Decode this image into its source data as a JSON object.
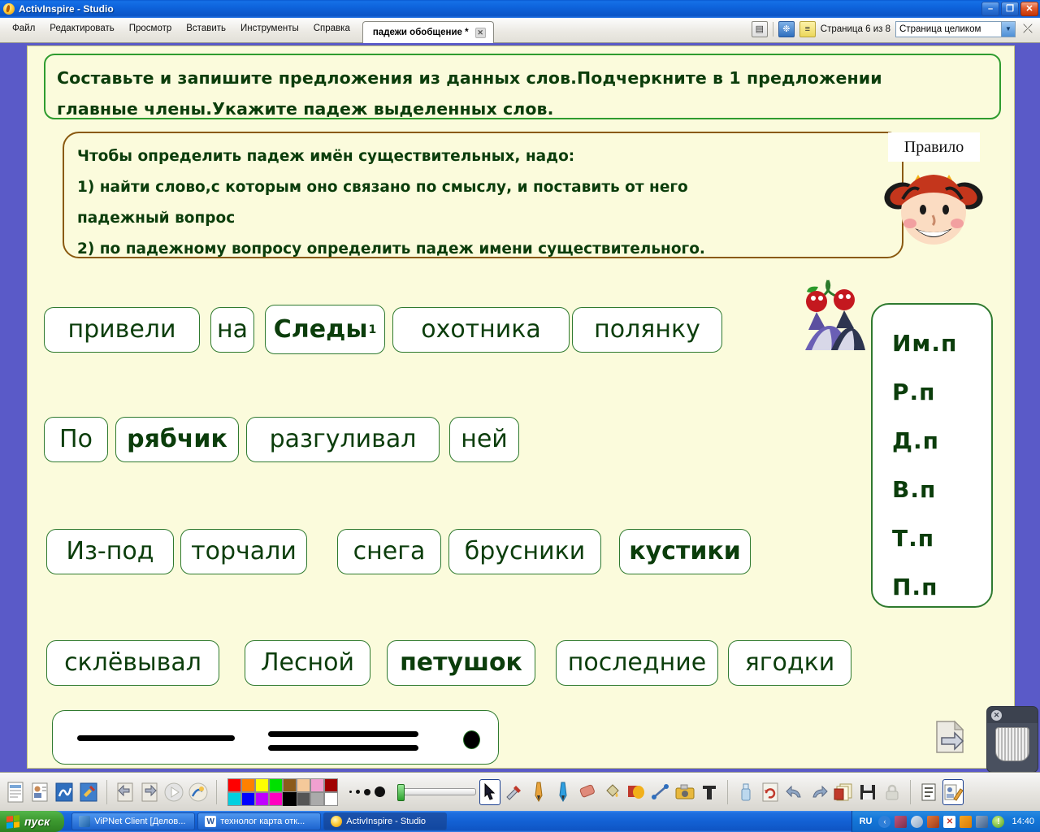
{
  "window": {
    "title": "ActivInspire - Studio",
    "app_icon": "flame-icon",
    "controls": {
      "minimize": "–",
      "restore": "❐",
      "close": "✕"
    }
  },
  "menubar": {
    "items": [
      "Файл",
      "Редактировать",
      "Просмотр",
      "Вставить",
      "Инструменты",
      "Справка"
    ],
    "document_tab": {
      "label": "падежи обобщение *",
      "close": "✕"
    },
    "right": {
      "page_status": "Страница 6 из 8",
      "zoom_select": "Страница целиком",
      "icons": [
        "page-view-icon",
        "snowflake-icon",
        "notes-icon",
        "fullscreen-icon"
      ]
    }
  },
  "page": {
    "instruction": {
      "line1": "Составьте и запишите предложения из данных слов.Подчеркните в 1 предложении",
      "line2": "главные члены.Укажите падеж выделенных слов."
    },
    "rule": {
      "label": "Правило",
      "line1": "Чтобы определить падеж имён существительных, надо:",
      "line2": "1) найти слово,с которым оно связано по смыслу, и поставить от него",
      "line3": "падежный вопрос",
      "line4": "2) по падежному вопросу определить падеж имени существительного."
    },
    "cases": [
      "Им.п",
      "Р.п",
      "Д.п",
      "В.п",
      "Т.п",
      "П.п"
    ],
    "word_rows": [
      [
        {
          "text": "привели",
          "bold": false,
          "sup": ""
        },
        {
          "text": "на",
          "bold": false,
          "sup": ""
        },
        {
          "text": "Следы",
          "bold": true,
          "sup": "1"
        },
        {
          "text": "охотника",
          "bold": false,
          "sup": ""
        },
        {
          "text": "полянку",
          "bold": false,
          "sup": ""
        }
      ],
      [
        {
          "text": "По",
          "bold": false,
          "sup": ""
        },
        {
          "text": "рябчик",
          "bold": true,
          "sup": ""
        },
        {
          "text": "разгуливал",
          "bold": false,
          "sup": ""
        },
        {
          "text": "ней",
          "bold": false,
          "sup": ""
        }
      ],
      [
        {
          "text": "Из-под",
          "bold": false,
          "sup": ""
        },
        {
          "text": "торчали",
          "bold": false,
          "sup": ""
        },
        {
          "text": "снега",
          "bold": false,
          "sup": ""
        },
        {
          "text": "брусники",
          "bold": false,
          "sup": ""
        },
        {
          "text": "кустики",
          "bold": true,
          "sup": ""
        }
      ],
      [
        {
          "text": "склёвывал",
          "bold": false,
          "sup": ""
        },
        {
          "text": "Лесной",
          "bold": false,
          "sup": ""
        },
        {
          "text": "петушок",
          "bold": true,
          "sup": ""
        },
        {
          "text": "последние",
          "bold": false,
          "sup": ""
        },
        {
          "text": "ягодки",
          "bold": false,
          "sup": ""
        }
      ]
    ],
    "legend": {
      "symbols": [
        "single-underline",
        "double-underline",
        "dot"
      ]
    },
    "next_page_icon": "next-page-arrow-icon",
    "trash_icon": "trash-bin-icon"
  },
  "toolbar": {
    "icons": [
      "properties-icon",
      "profile-icon",
      "handwriting-icon",
      "settings-icon",
      "prev-page-icon",
      "next-page-icon",
      "play-icon",
      "magic-ink-icon",
      "cursor-icon",
      "tools-icon",
      "pen-icon",
      "highlighter-icon",
      "eraser-icon",
      "fill-icon",
      "shapes-icon",
      "connector-icon",
      "camera-icon",
      "text-icon",
      "clear-icon",
      "reset-icon",
      "undo-icon",
      "redo-icon",
      "duplicate-icon",
      "save-icon",
      "lock-icon",
      "page-notes-icon",
      "annotate-icon"
    ],
    "palette_row1": [
      "#ff0000",
      "#ff8000",
      "#ffff00",
      "#00e000",
      "#8b5a1a",
      "#f5c99a",
      "#f0a0d0",
      "#a00000"
    ],
    "palette_row2": [
      "#00d0e0",
      "#0000ff",
      "#c000ff",
      "#ff00c0",
      "#000000",
      "#555555",
      "#aaaaaa",
      "#ffffff"
    ],
    "selected_color": "#000000",
    "pen_sizes": [
      3,
      5,
      8,
      13
    ],
    "selected_tool": "cursor-icon"
  },
  "taskbar": {
    "start_label": "пуск",
    "tasks": [
      {
        "label": "ViPNet Client [Делов...",
        "icon": "vipnet-icon",
        "active": false
      },
      {
        "label": "технолог карта отк...",
        "icon": "word-icon",
        "active": false
      },
      {
        "label": "ActivInspire - Studio",
        "icon": "flame-icon",
        "active": true
      }
    ],
    "tray": {
      "language": "RU",
      "clock": "14:40",
      "icons": [
        "show-desktop-icon",
        "network-icon",
        "search-icon",
        "cleaner-icon",
        "antivirus-icon",
        "orange-icon",
        "connection-icon",
        "info-icon"
      ]
    }
  },
  "colors": {
    "canvas": "#fbfbdc",
    "desktop": "#5a5ac8",
    "ink_green": "#0b3d0b",
    "chip_border": "#2f7a2f",
    "rule_border": "#8a5a10",
    "instr_border": "#2f9c2f"
  }
}
